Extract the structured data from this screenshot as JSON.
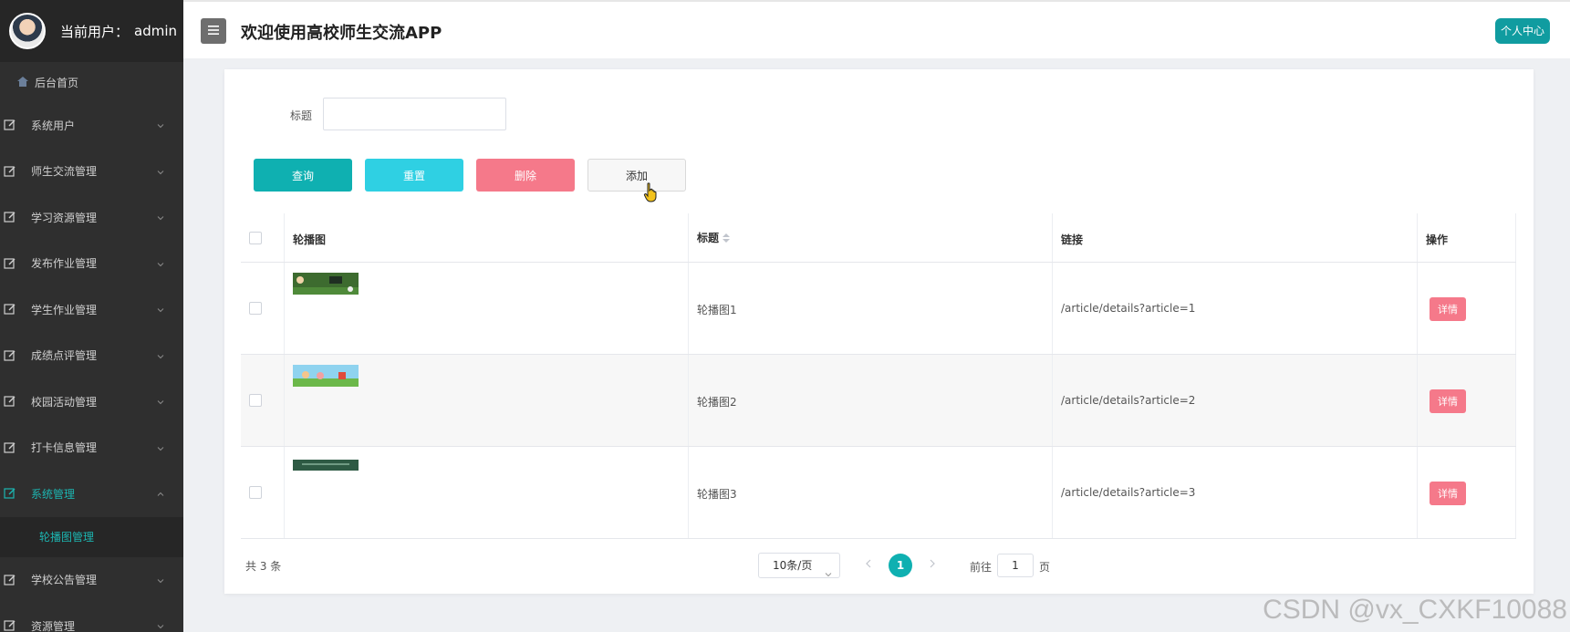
{
  "sidebar": {
    "user_label": "当前用户：",
    "user_name": "admin",
    "home": "后台首页",
    "items": [
      {
        "label": "系统用户"
      },
      {
        "label": "师生交流管理"
      },
      {
        "label": "学习资源管理"
      },
      {
        "label": "发布作业管理"
      },
      {
        "label": "学生作业管理"
      },
      {
        "label": "成绩点评管理"
      },
      {
        "label": "校园活动管理"
      },
      {
        "label": "打卡信息管理"
      },
      {
        "label": "系统管理"
      },
      {
        "label": "学校公告管理"
      },
      {
        "label": "资源管理"
      }
    ],
    "submenu": {
      "label": "轮播图管理"
    }
  },
  "header": {
    "title": "欢迎使用高校师生交流APP",
    "personal_center": "个人中心"
  },
  "search": {
    "label": "标题",
    "value": ""
  },
  "toolbar": {
    "query": "查询",
    "reset": "重置",
    "delete": "删除",
    "add": "添加"
  },
  "table": {
    "columns": {
      "image": "轮播图",
      "title": "标题",
      "link": "链接",
      "action": "操作"
    },
    "rows": [
      {
        "title": "轮播图1",
        "link": "/article/details?article=1",
        "action": "详情"
      },
      {
        "title": "轮播图2",
        "link": "/article/details?article=2",
        "action": "详情"
      },
      {
        "title": "轮播图3",
        "link": "/article/details?article=3",
        "action": "详情"
      }
    ]
  },
  "pagination": {
    "total": "共 3 条",
    "page_size": "10条/页",
    "current_page": "1",
    "goto_label": "前往",
    "goto_value": "1",
    "goto_suffix": "页"
  },
  "watermark": "CSDN @vx_CXKF10088",
  "colors": {
    "primary": "#0fb0b1",
    "reset": "#2fd0e3",
    "danger": "#f5798a",
    "sidebar_bg": "#2f2f2f"
  }
}
